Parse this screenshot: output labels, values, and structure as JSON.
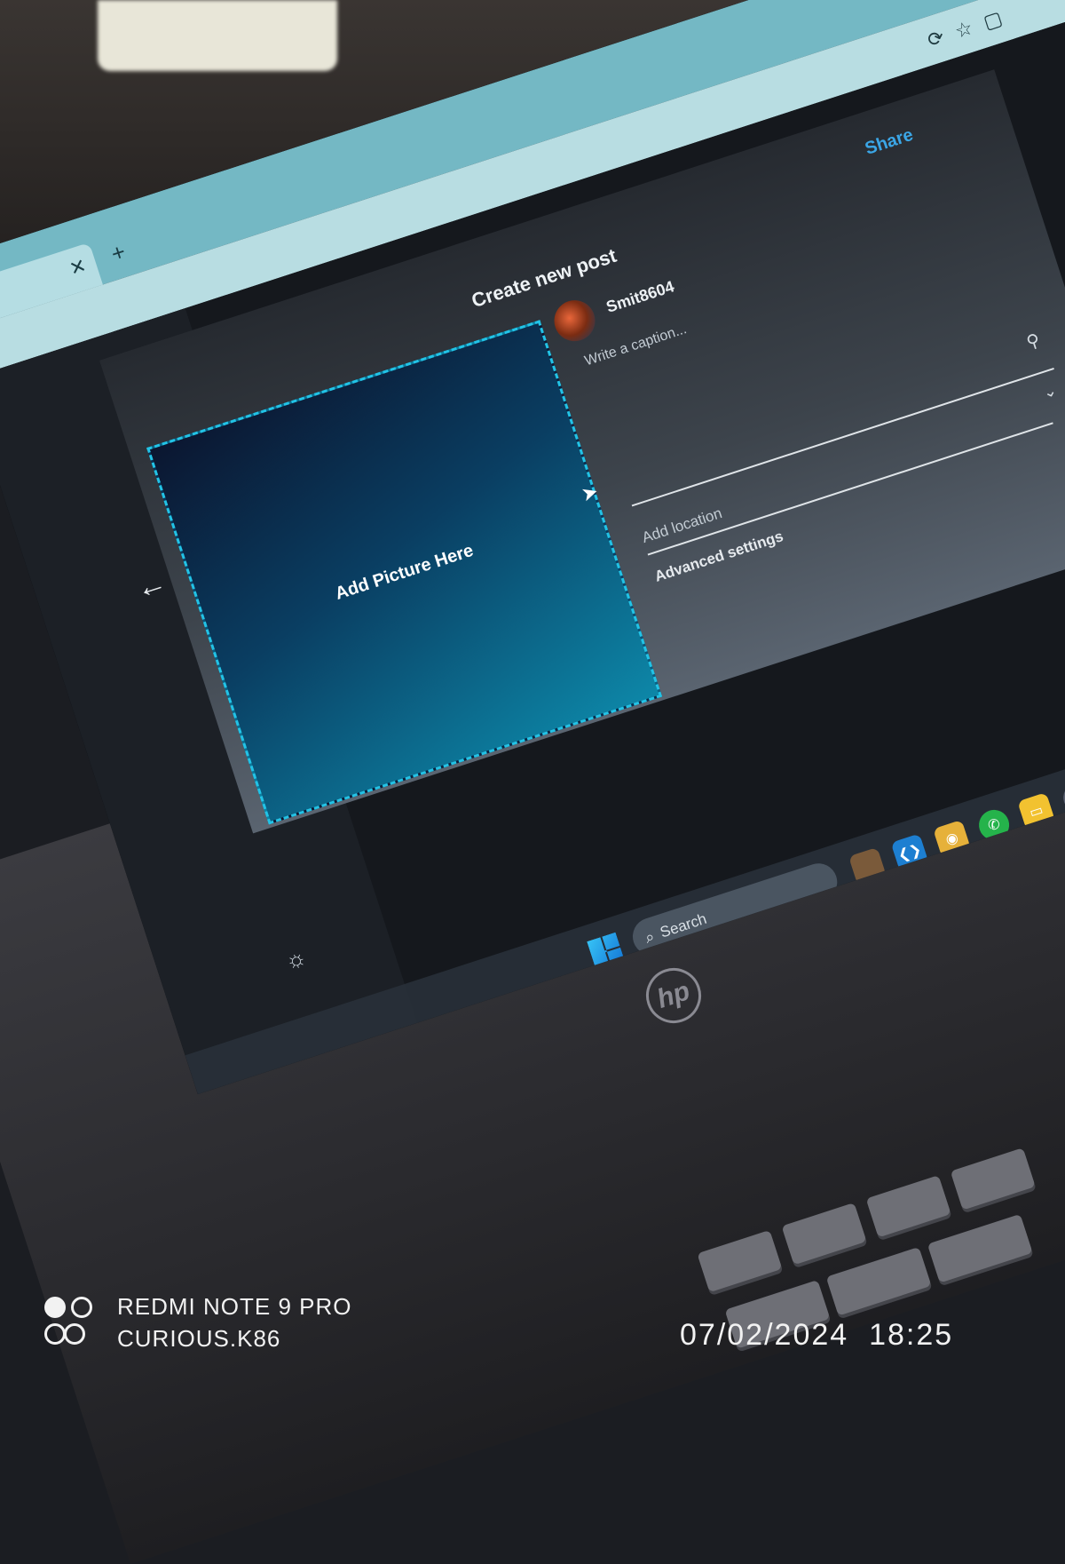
{
  "modal": {
    "title": "Create new post",
    "share_label": "Share",
    "dropzone_label": "Add Picture Here",
    "username": "Smit8604",
    "caption_placeholder": "Write a caption...",
    "location_placeholder": "Add location",
    "advanced_settings_label": "Advanced settings"
  },
  "taskbar": {
    "search_placeholder": "Search"
  },
  "watermark": {
    "device": "REDMI NOTE 9 PRO",
    "user": "CURIOUS.K86",
    "date": "07/02/2024",
    "time": "18:25"
  },
  "colors": {
    "share": "#3ba6e6",
    "dropzone_border": "#22c3e6"
  },
  "icons": {
    "back": "arrow-left-icon",
    "location": "map-pin-icon",
    "chevron": "chevron-down-icon",
    "search": "search-icon",
    "settings": "sun-icon"
  }
}
